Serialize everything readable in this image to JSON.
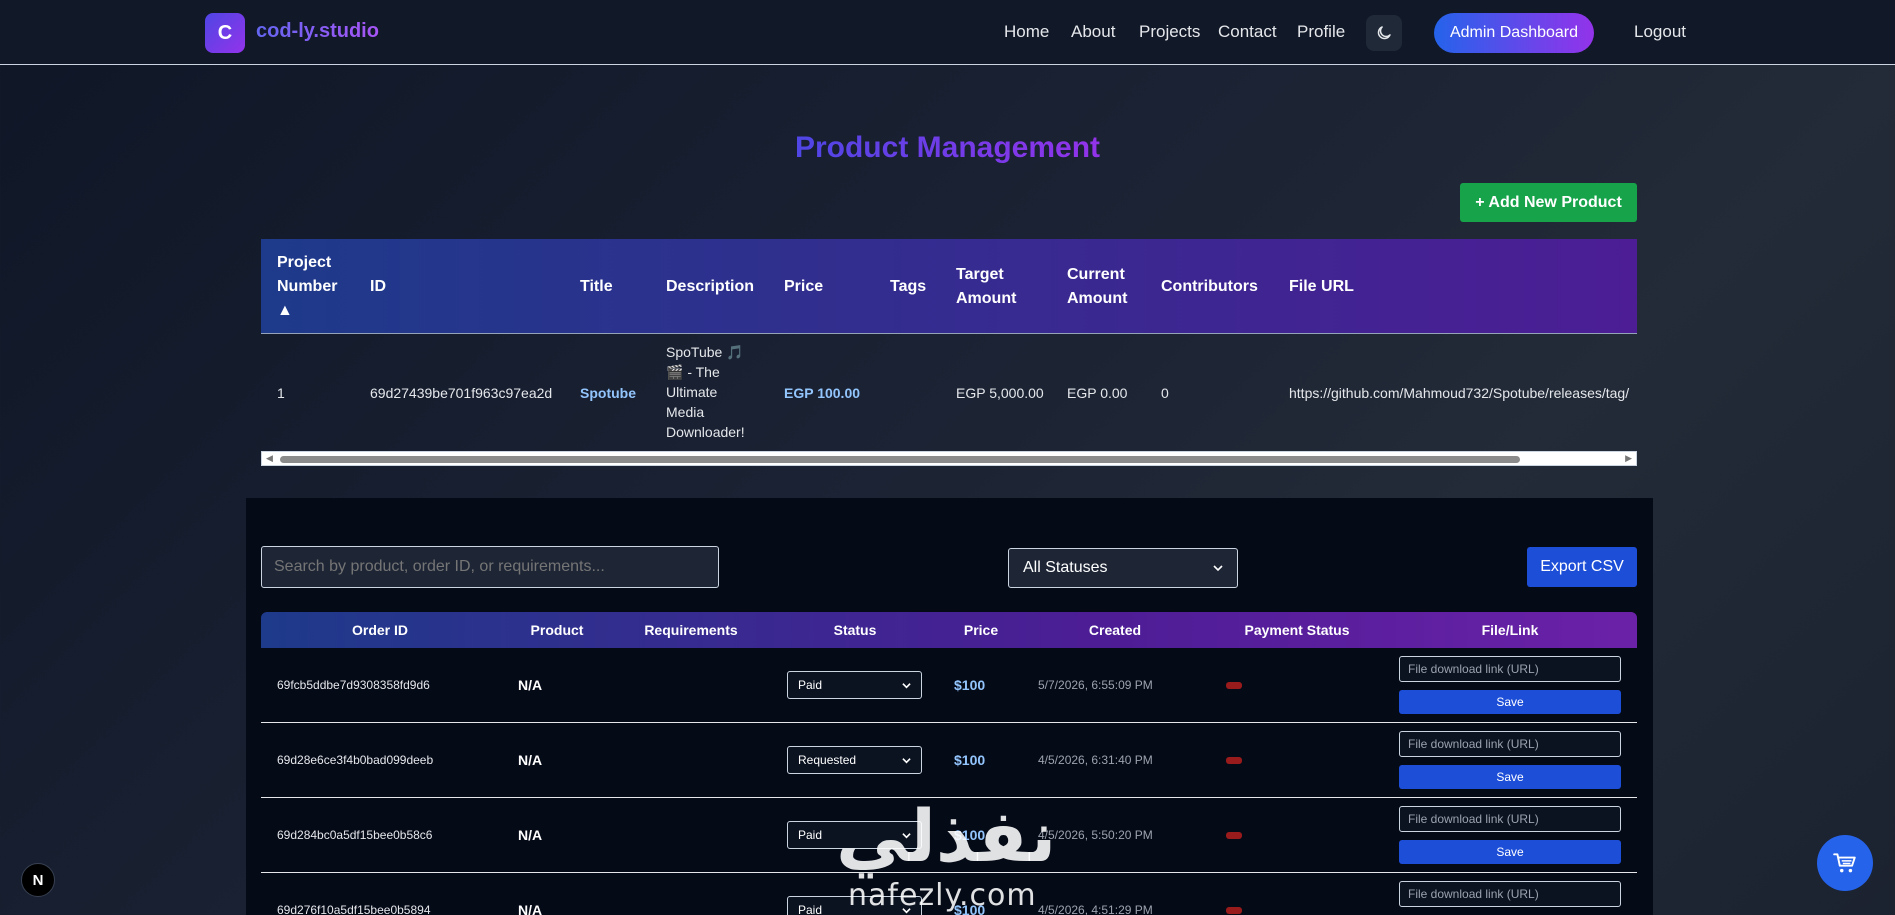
{
  "navbar": {
    "logo_letter": "C",
    "brand": "cod-ly.studio",
    "links": [
      "Home",
      "About",
      "Projects",
      "Contact",
      "Profile"
    ],
    "theme_icon": "moon-icon",
    "admin_label": "Admin Dashboard",
    "logout_label": "Logout"
  },
  "page": {
    "title": "Product Management",
    "add_button": "+ Add New Product"
  },
  "products": {
    "columns": [
      "Project Number",
      "ID",
      "Title",
      "Description",
      "Price",
      "Tags",
      "Target Amount",
      "Current Amount",
      "Contributors",
      "File URL"
    ],
    "sort_indicator": "▲",
    "rows": [
      {
        "number": "1",
        "id": "69d27439be701f963c97ea2d",
        "title": "Spotube",
        "description": "SpoTube 🎵 🎬 - The Ultimate Media Downloader!",
        "price": "EGP 100.00",
        "tags": "",
        "target": "EGP 5,000.00",
        "current": "EGP 0.00",
        "contributors": "0",
        "file_url": "https://github.com/Mahmoud732/Spotube/releases/tag/"
      }
    ]
  },
  "orders": {
    "search_placeholder": "Search by product, order ID, or requirements...",
    "status_filter": "All Statuses",
    "export_label": "Export CSV",
    "columns": [
      "Order ID",
      "Product",
      "Requirements",
      "Status",
      "Price",
      "Created",
      "Payment Status",
      "File/Link"
    ],
    "file_placeholder": "File download link (URL)",
    "save_label": "Save",
    "rows": [
      {
        "id": "69fcb5ddbe7d9308358fd9d6",
        "product": "N/A",
        "requirements": "",
        "status": "Paid",
        "price": "$100",
        "created": "5/7/2026, 6:55:09 PM"
      },
      {
        "id": "69d28e6ce3f4b0bad099deeb",
        "product": "N/A",
        "requirements": "",
        "status": "Requested",
        "price": "$100",
        "created": "4/5/2026, 6:31:40 PM"
      },
      {
        "id": "69d284bc0a5df15bee0b58c6",
        "product": "N/A",
        "requirements": "",
        "status": "Paid",
        "price": "$100",
        "created": "4/5/2026, 5:50:20 PM"
      },
      {
        "id": "69d276f10a5df15bee0b5894",
        "product": "N/A",
        "requirements": "",
        "status": "Paid",
        "price": "$100",
        "created": "4/5/2026, 4:51:29 PM"
      }
    ]
  },
  "floating": {
    "badge_letter": "N",
    "cart_icon": "cart-icon"
  },
  "watermark": {
    "arabic": "نفذلي",
    "latin": "nafezly.com"
  },
  "colors": {
    "accent_green": "#16a34a",
    "accent_blue": "#1d4ed8",
    "header_gradient_start": "#1e3a8a",
    "header_gradient_end": "#4c1d95"
  }
}
